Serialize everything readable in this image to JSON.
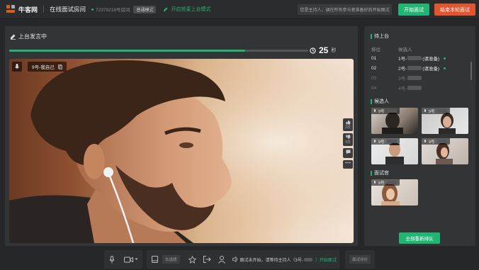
{
  "header": {
    "logo_text": "牛客网",
    "room_title": "在线面试房间",
    "room_id": "72379218号房间",
    "mode_badge": "普通模式",
    "discuss_mode": "开启抢麦上台模式",
    "notice": "您是主持人，调在所有参与者准备好后开始面试",
    "start_button": "开始面试",
    "end_button": "结束本轮面试",
    "colors": {
      "accent": "#21b574",
      "danger": "#e5542c"
    }
  },
  "stage": {
    "title": "上台发言中",
    "progress": 0.79,
    "timer_value": "25",
    "timer_unit": "秒",
    "speaker_label": "9号-我自己",
    "side_tools": [
      {
        "icon": "thumbs-up-icon",
        "count": "2次"
      },
      {
        "icon": "thumbs-down-icon",
        "count": "4次"
      },
      {
        "icon": "flag-icon",
        "count": ""
      },
      {
        "icon": "more-icon",
        "count": ""
      }
    ]
  },
  "queue": {
    "title": "待上台",
    "col_rank": "排位",
    "col_candidate": "候选人",
    "rows": [
      {
        "rank": "01",
        "name": "1号-",
        "status": "(请准备)",
        "active": true
      },
      {
        "rank": "02",
        "name": "2号-",
        "status": "(请准备)",
        "active": true
      },
      {
        "rank": "03",
        "name": "3号-",
        "status": "",
        "active": false
      },
      {
        "rank": "04",
        "name": "4号-",
        "status": "",
        "active": false
      }
    ]
  },
  "candidates": {
    "title": "候选人",
    "items": [
      {
        "label": "9号"
      },
      {
        "label": "9号"
      },
      {
        "label": "9号"
      },
      {
        "label": "9号"
      }
    ]
  },
  "interviewers": {
    "title": "面试官",
    "items": [
      {
        "label": "9号"
      }
    ]
  },
  "resort_button": "全部重新排队",
  "bottom": {
    "whiteboard_pill": "去选题",
    "status_text": "面试未开始，请等待主持人（3号-",
    "status_suffix": "）开始面试",
    "evaluate": "面试评价"
  }
}
